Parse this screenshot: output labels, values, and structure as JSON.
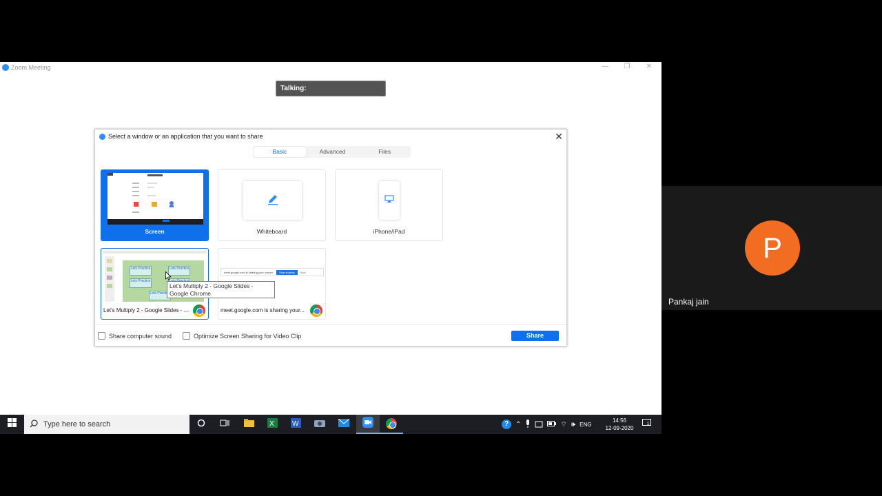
{
  "zoom_window": {
    "title": "Zoom Meeting",
    "minimize": "—",
    "restore": "❐",
    "close": "✕",
    "talking_label": "Talking:"
  },
  "dialog": {
    "title": "Select a window or an application that you want to share",
    "close": "✕",
    "tabs": [
      {
        "label": "Basic",
        "active": true
      },
      {
        "label": "Advanced",
        "active": false
      },
      {
        "label": "Files",
        "active": false
      }
    ],
    "tiles": {
      "screen": "Screen",
      "whiteboard": "Whiteboard",
      "iphone": "iPhone/iPad",
      "slides": "Let's Multiply 2 - Google Slides - ...",
      "meet": "meet.google.com is sharing your..."
    },
    "tooltip": "Let's Multiply 2 - Google Slides - Google Chrome",
    "share_computer_sound": "Share computer sound",
    "optimize_video": "Optimize Screen Sharing for Video Clip",
    "share_button": "Share",
    "slides_thumb_labels": [
      "Lets Practice",
      "Lets Practice",
      "Lets Practice",
      "Lets Practice",
      "Lets Practice"
    ],
    "meet_thumb_text": "meet.google.com is sharing your screen.",
    "meet_thumb_button": "Stop sharing",
    "meet_thumb_hide": "Hide"
  },
  "taskbar": {
    "search_placeholder": "Type here to search",
    "language": "ENG",
    "time": "14:56",
    "date": "12-09-2020",
    "notification_count": "1"
  },
  "participant": {
    "initial": "P",
    "name": "Pankaj jain",
    "avatar_color": "#f26d21"
  },
  "colors": {
    "accent": "#0e71eb",
    "taskbar": "#1d1e23"
  }
}
